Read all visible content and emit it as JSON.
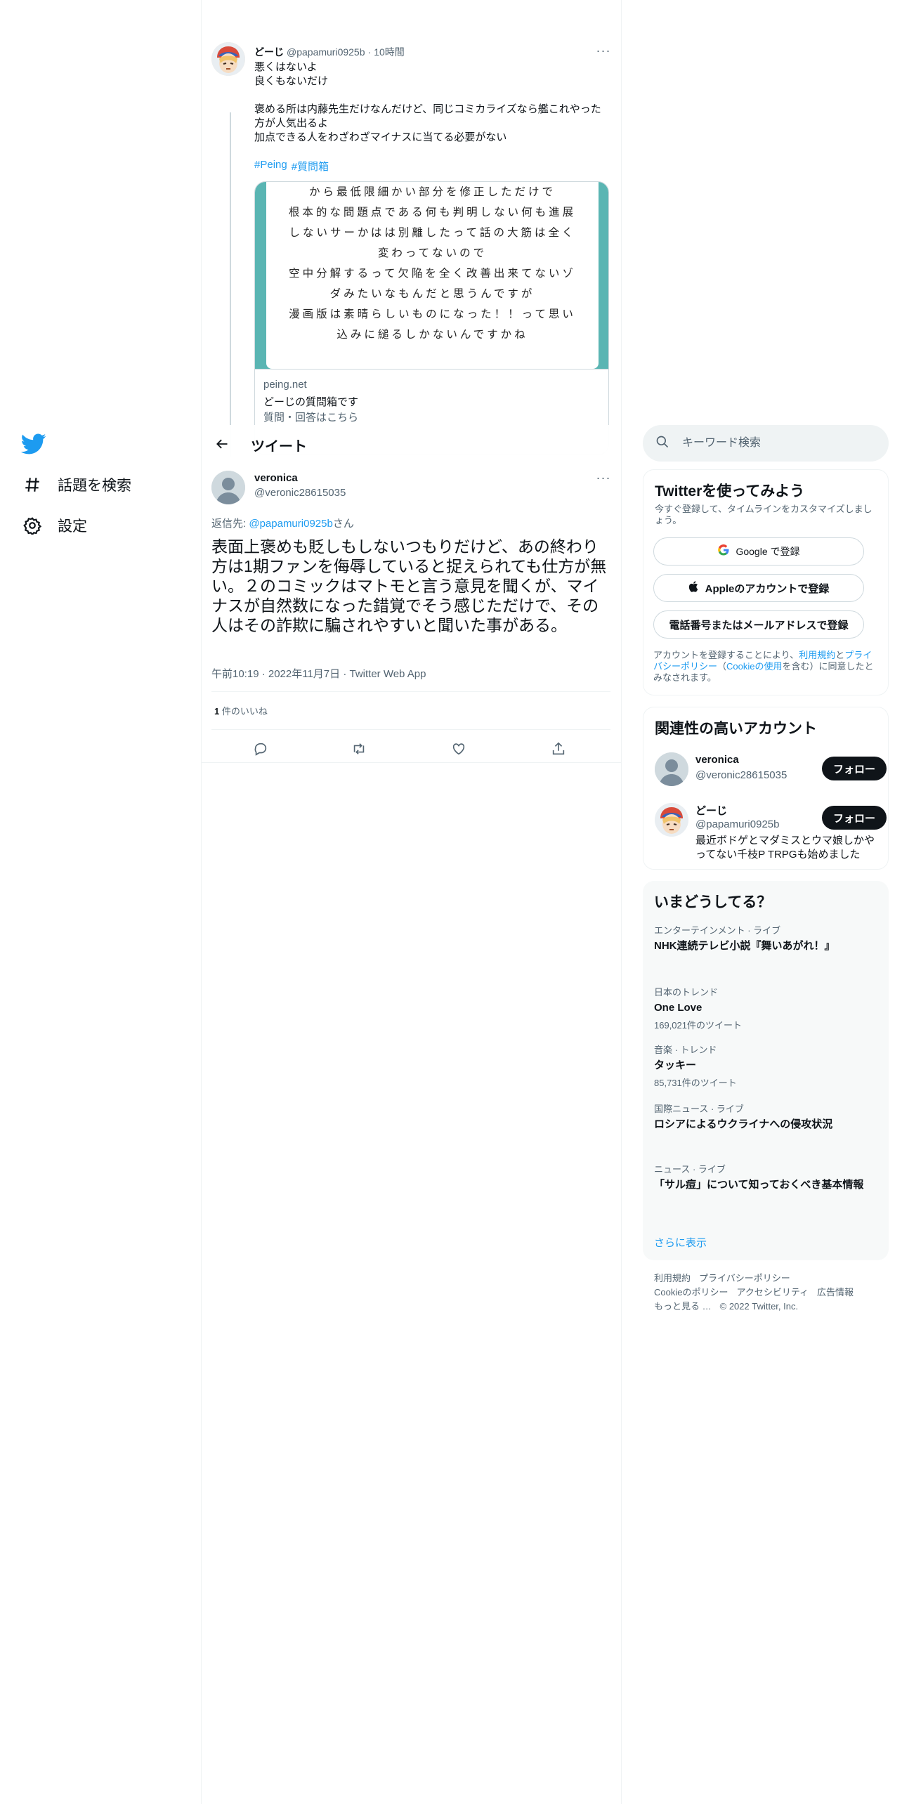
{
  "nav": {
    "items": [
      {
        "label": "話題を検索"
      },
      {
        "label": "設定"
      }
    ]
  },
  "header": {
    "title": "ツイート"
  },
  "context_tweet": {
    "name": "どーじ",
    "handle": "@papamuri0925b",
    "time": "10時間",
    "lines": [
      "悪くはないよ",
      "良くもないだけ",
      "",
      "褒める所は内藤先生だけなんだけど、同じコミカライズなら艦これやった方が人気出るよ",
      "加点できる人をわざわざマイナスに当てる必要がない"
    ],
    "hashtags": [
      "#Peing",
      "#質問箱"
    ],
    "card": {
      "image_text": [
        "から最低限細かい部分を修正しただけで",
        "根本的な問題点である何も判明しない何も進展",
        "しないサーかはは別離したって話の大筋は全く",
        "変わってないので",
        "空中分解するって欠陥を全く改善出来てないゾ",
        "ダみたいなもんだと思うんですが",
        "漫画版は素晴らしいものになった！！って思い",
        "込みに縋るしかないんですかね"
      ],
      "domain": "peing.net",
      "title": "どーじの質問箱です",
      "description": "質問・回答はこちら"
    }
  },
  "focus_tweet": {
    "name": "veronica",
    "handle": "@veronic28615035",
    "reply_prefix": "返信先: ",
    "reply_handle": "@papamuri0925b",
    "reply_suffix": "さん",
    "text": "表面上褒めも貶しもしないつもりだけど、あの終わり方は1期ファンを侮辱していると捉えられても仕方が無い。２のコミックはマトモと言う意見を聞くが、マイナスが自然数になった錯覚でそう感じただけで、その人はその詐欺に騙されやすいと聞いた事がある。",
    "meta": "午前10:19 · 2022年11月7日 · Twitter Web App",
    "likes_count": "1",
    "likes_label": " 件のいいね"
  },
  "search": {
    "placeholder": "キーワード検索"
  },
  "signup": {
    "title": "Twitterを使ってみよう",
    "subtitle": "今すぐ登録して、タイムラインをカスタマイズしましょう。",
    "google": "Google で登録",
    "apple": "Appleのアカウントで登録",
    "phone": "電話番号またはメールアドレスで登録",
    "legal_1": "アカウントを登録することにより、",
    "legal_terms": "利用規約",
    "legal_2": "と",
    "legal_privacy": "プライバシーポリシー",
    "legal_3": "（",
    "legal_cookie": "Cookieの使用",
    "legal_4": "を含む）に同意したとみなされます。"
  },
  "relevant": {
    "title": "関連性の高いアカウント",
    "accounts": [
      {
        "name": "veronica",
        "handle": "@veronic28615035",
        "bio": "",
        "follow": "フォロー"
      },
      {
        "name": "どーじ",
        "handle": "@papamuri0925b",
        "bio": "最近ボドゲとマダミスとウマ娘しかやってない千枝P TRPGも始めました",
        "follow": "フォロー"
      }
    ]
  },
  "trends": {
    "title": "いまどうしてる？",
    "items": [
      {
        "category": "エンターテインメント · ライブ",
        "topic": "NHK連続テレビ小説『舞いあがれ！』",
        "count": ""
      },
      {
        "category": "日本のトレンド",
        "topic": "One Love",
        "count": "169,021件のツイート"
      },
      {
        "category": "音楽 · トレンド",
        "topic": "タッキー",
        "count": "85,731件のツイート"
      },
      {
        "category": "国際ニュース · ライブ",
        "topic": "ロシアによるウクライナへの侵攻状況",
        "count": ""
      },
      {
        "category": "ニュース · ライブ",
        "topic": "「サル痘」について知っておくべき基本情報",
        "count": ""
      }
    ],
    "show_more": "さらに表示"
  },
  "footer": {
    "links": [
      "利用規約",
      "プライバシーポリシー",
      "Cookieのポリシー",
      "アクセシビリティ",
      "広告情報",
      "もっと見る …"
    ],
    "copyright": "© 2022 Twitter, Inc."
  }
}
